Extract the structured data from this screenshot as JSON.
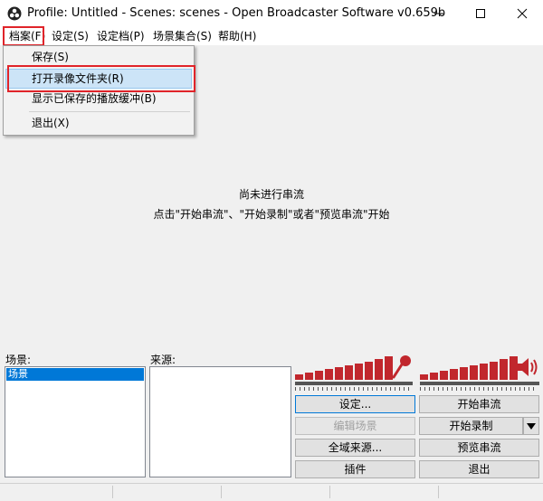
{
  "window": {
    "title": "Profile: Untitled - Scenes: scenes - Open Broadcaster Software v0.659b",
    "controls": [
      "minimize-icon",
      "maximize-icon",
      "close-icon"
    ]
  },
  "menubar": {
    "items": [
      "档案(F)",
      "设定(S)",
      "设定档(P)",
      "场景集合(S)",
      "帮助(H)"
    ]
  },
  "dropdown": {
    "items": [
      "保存(S)",
      "打开录像文件夹(R)",
      "显示已保存的播放缓冲(B)",
      "退出(X)"
    ],
    "highlighted_index": 1
  },
  "main": {
    "status_line1": "尚未进行串流",
    "status_line2": "点击\"开始串流\"、\"开始录制\"或者\"预览串流\"开始"
  },
  "panels": {
    "scenes_label": "场景:",
    "sources_label": "来源:",
    "scenes": [
      "场景"
    ],
    "selected_scene_index": 0
  },
  "buttons": {
    "settings": "设定...",
    "edit_scene": "编辑场景",
    "global_sources": "全域来源...",
    "plugins": "插件",
    "start_stream": "开始串流",
    "start_record": "开始录制",
    "preview_stream": "预览串流",
    "exit": "退出"
  },
  "meters": {
    "mic_icon": "microphone-icon",
    "speaker_icon": "speaker-icon"
  },
  "colors": {
    "accent_highlight": "#cce4f7",
    "annotation_red": "#e0242a",
    "meter_red": "#c1272d",
    "selection_blue": "#0078d7"
  }
}
